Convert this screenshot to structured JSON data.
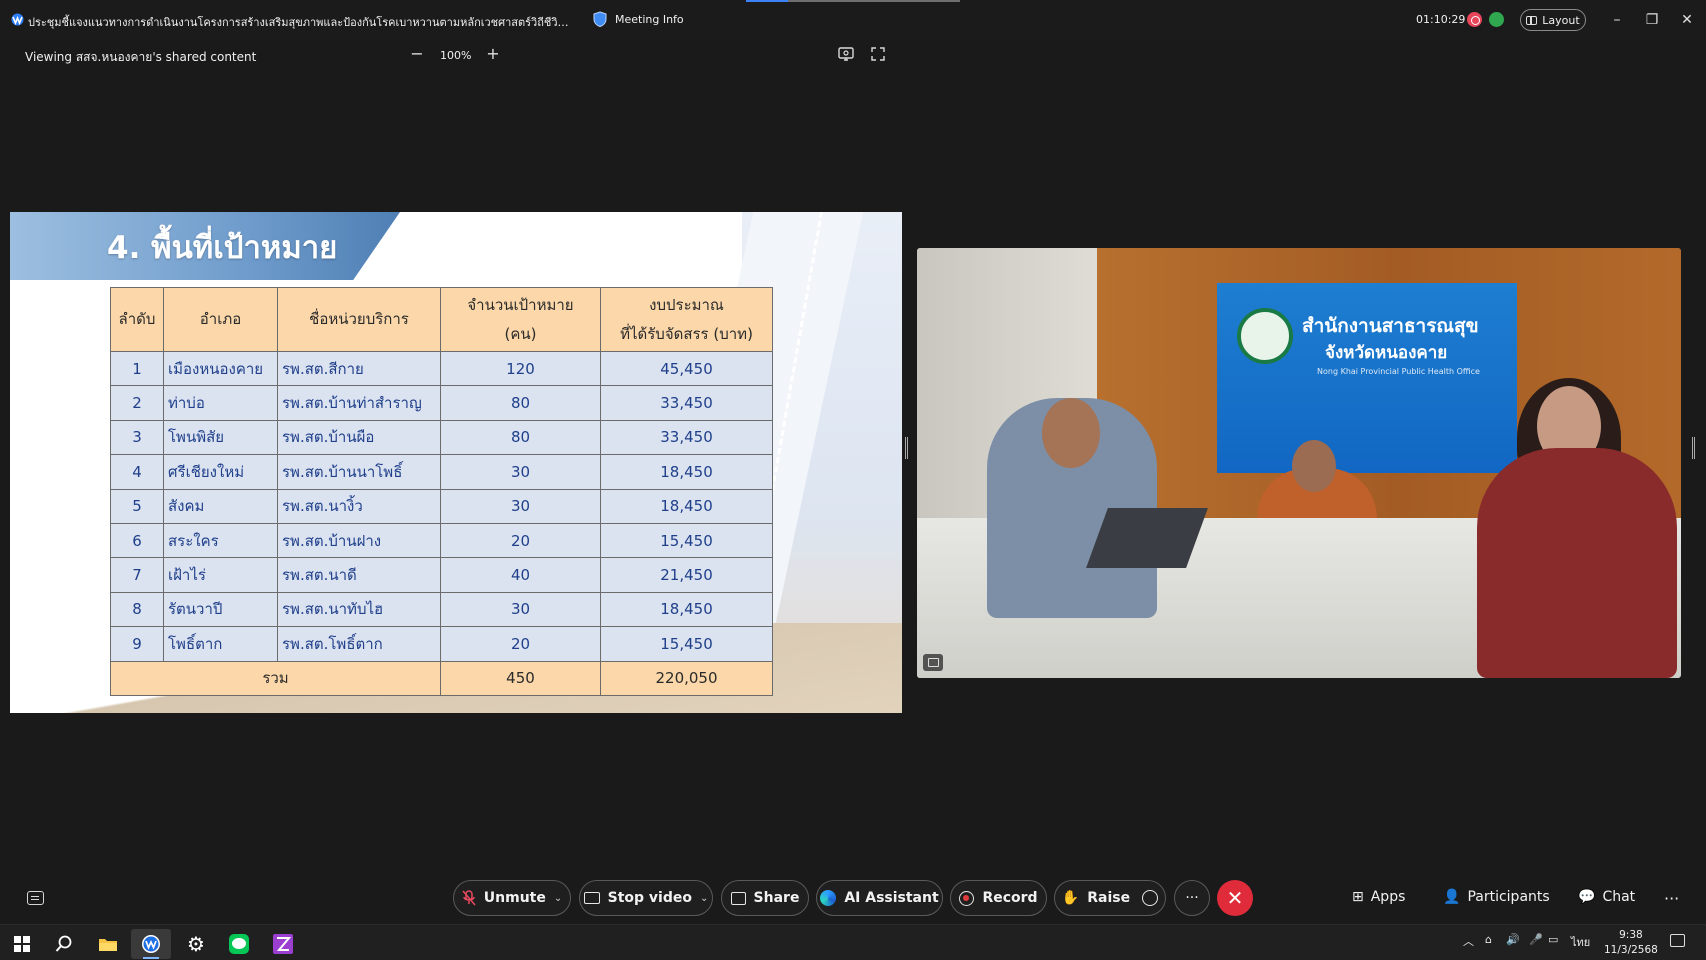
{
  "window": {
    "meeting_title": "ประชุมชี้แจงแนวทางการดำเนินงานโครงการสร้างเสริมสุขภาพและป้องกันโรคเบาหวานตามหลักเวชศาสตร์วิถีชีวิต (Lifesty...",
    "meeting_info_label": "Meeting Info",
    "timer": "01:10:29",
    "layout_label": "Layout",
    "minimize": "–",
    "maximize": "❐",
    "close": "✕"
  },
  "share_bar": {
    "viewing_label": "Viewing สสจ.หนองคาย's shared content",
    "zoom_minus": "−",
    "zoom_value": "100%",
    "zoom_plus": "+"
  },
  "slide": {
    "title": "4. พื้นที่เป้าหมาย",
    "headers": [
      "ลำดับ",
      "อำเภอ",
      "ชื่อหน่วยบริการ",
      "จำนวนเป้าหมาย (คน)",
      "งบประมาณ ที่ได้รับจัดสรร (บาท)"
    ],
    "header_lines": {
      "target_line1": "จำนวนเป้าหมาย",
      "target_line2": "(คน)",
      "budget_line1": "งบประมาณ",
      "budget_line2": "ที่ได้รับจัดสรร (บาท)"
    },
    "rows": [
      {
        "no": "1",
        "district": "เมืองหนองคาย",
        "unit": "รพ.สต.สีกาย",
        "target": "120",
        "budget": "45,450"
      },
      {
        "no": "2",
        "district": "ท่าบ่อ",
        "unit": "รพ.สต.บ้านท่าสำราญ",
        "target": "80",
        "budget": "33,450"
      },
      {
        "no": "3",
        "district": "โพนพิสัย",
        "unit": "รพ.สต.บ้านผือ",
        "target": "80",
        "budget": "33,450"
      },
      {
        "no": "4",
        "district": "ศรีเชียงใหม่",
        "unit": "รพ.สต.บ้านนาโพธิ์",
        "target": "30",
        "budget": "18,450"
      },
      {
        "no": "5",
        "district": "สังคม",
        "unit": "รพ.สต.นางิ้ว",
        "target": "30",
        "budget": "18,450"
      },
      {
        "no": "6",
        "district": "สระใคร",
        "unit": "รพ.สต.บ้านฝาง",
        "target": "20",
        "budget": "15,450"
      },
      {
        "no": "7",
        "district": "เฝ้าไร่",
        "unit": "รพ.สต.นาดี",
        "target": "40",
        "budget": "21,450"
      },
      {
        "no": "8",
        "district": "รัตนวาปี",
        "unit": "รพ.สต.นาทับไฮ",
        "target": "30",
        "budget": "18,450"
      },
      {
        "no": "9",
        "district": "โพธิ์ตาก",
        "unit": "รพ.สต.โพธิ์ตาก",
        "target": "20",
        "budget": "15,450"
      }
    ],
    "total": {
      "label": "รวม",
      "target": "450",
      "budget": "220,050"
    }
  },
  "video": {
    "sign_line1": "สำนักงานสาธารณสุข",
    "sign_line2": "จังหวัดหนองคาย",
    "sign_line3": "Nong Khai Provincial Public Health Office"
  },
  "controls": {
    "unmute": "Unmute",
    "stop_video": "Stop video",
    "share": "Share",
    "ai_assistant": "AI Assistant",
    "record": "Record",
    "raise": "Raise",
    "more": "···",
    "leave": "✕",
    "apps": "Apps",
    "participants": "Participants",
    "chat": "Chat",
    "overflow": "···"
  },
  "taskbar": {
    "lang": "ไทย",
    "time": "9:38",
    "date": "11/3/2568"
  },
  "colors": {
    "accent_blue": "#3b82f6",
    "leave_red": "#e02c3a",
    "header_orange": "#fbd7a9",
    "cell_blue": "#dbe3f1"
  }
}
